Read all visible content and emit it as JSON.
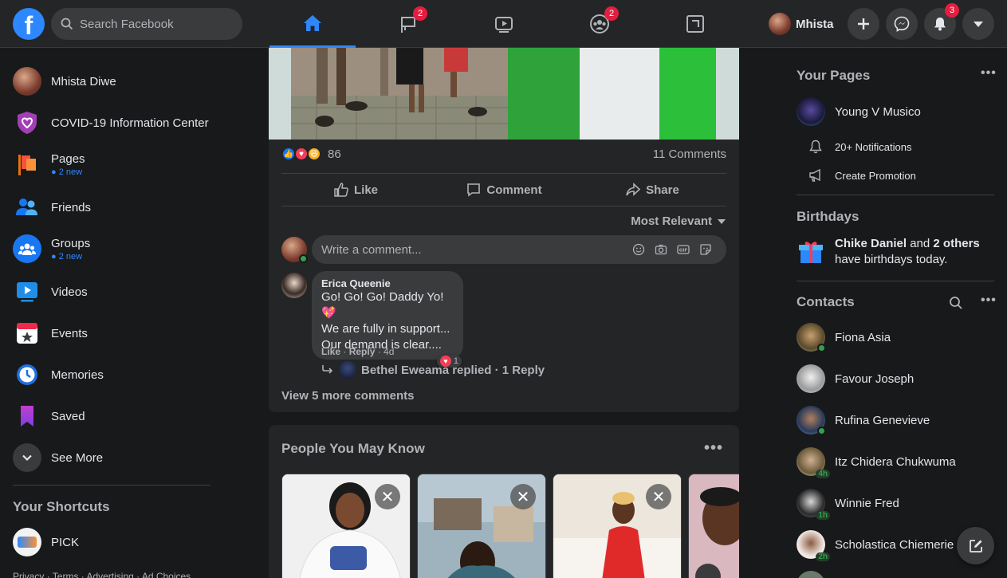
{
  "colors": {
    "accent": "#2d88ff",
    "badge": "#e41e3f",
    "online": "#31a24c"
  },
  "topbar": {
    "logo": "f",
    "search_placeholder": "Search Facebook",
    "tabs": [
      {
        "name": "home",
        "badge": ""
      },
      {
        "name": "pages",
        "badge": "2"
      },
      {
        "name": "watch",
        "badge": ""
      },
      {
        "name": "groups",
        "badge": "2"
      },
      {
        "name": "gaming",
        "badge": ""
      }
    ],
    "profile_name": "Mhista",
    "notifications_badge": "3"
  },
  "left_sidebar": {
    "items": [
      {
        "label": "Mhista Diwe",
        "sub": ""
      },
      {
        "label": "COVID-19 Information Center",
        "sub": ""
      },
      {
        "label": "Pages",
        "sub": "2 new"
      },
      {
        "label": "Friends",
        "sub": ""
      },
      {
        "label": "Groups",
        "sub": "2 new"
      },
      {
        "label": "Videos",
        "sub": ""
      },
      {
        "label": "Events",
        "sub": ""
      },
      {
        "label": "Memories",
        "sub": ""
      },
      {
        "label": "Saved",
        "sub": ""
      },
      {
        "label": "See More",
        "sub": ""
      }
    ],
    "shortcuts_title": "Your Shortcuts",
    "shortcuts": [
      {
        "label": "PICK"
      }
    ],
    "footer": "Privacy · Terms · Advertising · Ad Choices"
  },
  "post": {
    "reaction_count": "86",
    "comments_count": "11 Comments",
    "actions": {
      "like": "Like",
      "comment": "Comment",
      "share": "Share"
    },
    "sort_label": "Most Relevant",
    "comment_placeholder": "Write a comment...",
    "comment": {
      "author": "Erica Queenie",
      "lines": [
        "Go! Go! Go! Daddy Yo!💖",
        "We are fully in support...",
        "Our demand is clear...."
      ],
      "like": "Like",
      "reply": "Reply",
      "age": "4d",
      "reaction_count": "1"
    },
    "reply_summary": "Bethel Eweama replied · 1 Reply",
    "view_more": "View 5 more comments"
  },
  "pymk": {
    "title": "People You May Know"
  },
  "right_sidebar": {
    "pages_title": "Your Pages",
    "page_name": "Young V Musico",
    "page_notifications": "20+ Notifications",
    "page_promotion": "Create Promotion",
    "birthdays_title": "Birthdays",
    "birthday_bold": "Chike Daniel",
    "birthday_mid": " and ",
    "birthday_bold2": "2 others",
    "birthday_tail": "have birthdays today.",
    "contacts_title": "Contacts",
    "contacts": [
      {
        "name": "Fiona Asia",
        "status": "online",
        "ago": ""
      },
      {
        "name": "Favour Joseph",
        "status": "",
        "ago": ""
      },
      {
        "name": "Rufina Genevieve",
        "status": "online",
        "ago": ""
      },
      {
        "name": "Itz Chidera Chukwuma",
        "status": "",
        "ago": "4h"
      },
      {
        "name": "Winnie Fred",
        "status": "",
        "ago": "1h"
      },
      {
        "name": "Scholastica Chiemerie",
        "status": "",
        "ago": "2h"
      }
    ]
  }
}
